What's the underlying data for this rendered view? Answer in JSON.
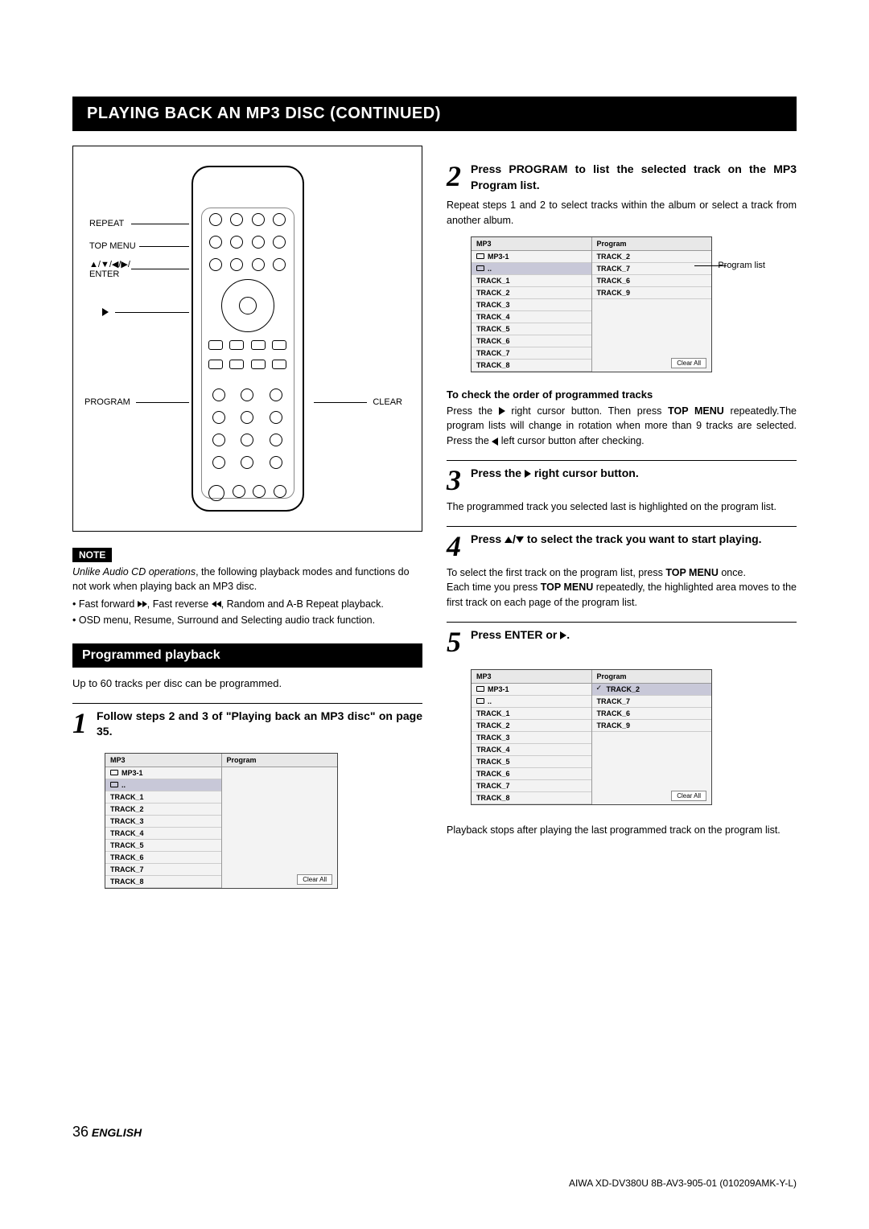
{
  "title": "PLAYING BACK AN MP3 DISC (CONTINUED)",
  "remote_labels": {
    "repeat": "REPEAT",
    "topmenu": "TOP MENU",
    "dpad": "▲/▼/◀/▶/\nENTER",
    "play": "▶",
    "program": "PROGRAM",
    "clear": "CLEAR"
  },
  "note": {
    "label": "NOTE",
    "intro_italic": "Unlike Audio CD operations",
    "intro_rest": ", the following playback modes and functions do not work when playing back an MP3 disc.",
    "b1_pre": "• Fast forward ",
    "b1_mid": ", Fast reverse ",
    "b1_post": ", Random and A-B Repeat playback.",
    "b2": "• OSD menu, Resume, Surround and Selecting audio track function."
  },
  "section_head": "Programmed playback",
  "prog_intro": "Up to 60 tracks per disc can be programmed.",
  "step1": {
    "num": "1",
    "title": "Follow steps 2 and 3 of \"Playing back an MP3 disc\" on page 35."
  },
  "step2": {
    "num": "2",
    "title": "Press PROGRAM to list the selected track on the MP3 Program list.",
    "body": "Repeat steps 1 and 2 to select tracks within the album or select a track from another album.",
    "annot": "Program list"
  },
  "sub_check": {
    "head": "To check the order of programmed tracks",
    "body_pre": "Press the ",
    "body_mid": " right cursor button. Then press ",
    "body_tm": "TOP MENU",
    "body_post": " repeatedly.The program lists will change in rotation when more than 9 tracks are selected. Press the ",
    "body_end": " left cursor button after checking."
  },
  "step3": {
    "num": "3",
    "title_pre": "Press the ",
    "title_post": " right cursor button.",
    "body": "The programmed track you selected last is highlighted on the program list."
  },
  "step4": {
    "num": "4",
    "title_pre": "Press ",
    "title_post": " to select the track you want to start playing.",
    "body_pre": "To select the first track on the program list, press ",
    "body_tm": "TOP MENU",
    "body_once": " once.",
    "body2_pre": "Each time you press ",
    "body2_post": " repeatedly, the highlighted area moves to the first track on each page of the program list."
  },
  "step5": {
    "num": "5",
    "title_pre": "Press ENTER or ",
    "title_post": ".",
    "body": "Playback stops after playing the last programmed track on the program list."
  },
  "onscreen": {
    "h_left": "MP3",
    "h_right": "Program",
    "folder": "MP3-1",
    "up": "..",
    "tracks_left": [
      "TRACK_1",
      "TRACK_2",
      "TRACK_3",
      "TRACK_4",
      "TRACK_5",
      "TRACK_6",
      "TRACK_7",
      "TRACK_8"
    ],
    "prog_list": [
      "TRACK_2",
      "TRACK_7",
      "TRACK_6",
      "TRACK_9"
    ],
    "clear": "Clear All"
  },
  "footer": {
    "page": "36",
    "lang": "ENGLISH",
    "docid": "AIWA XD-DV380U 8B-AV3-905-01 (010209AMK-Y-L)"
  }
}
